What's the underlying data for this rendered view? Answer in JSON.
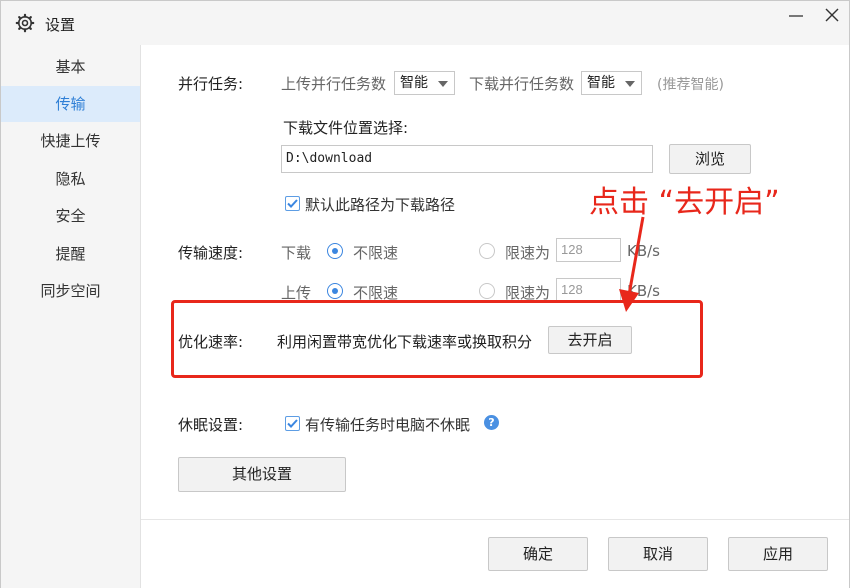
{
  "window": {
    "title": "设置",
    "icons": {
      "title": "gear-icon",
      "minimize": "minimize-icon",
      "close": "close-icon"
    }
  },
  "sidebar": {
    "items": [
      {
        "label": "基本",
        "active": false
      },
      {
        "label": "传输",
        "active": true
      },
      {
        "label": "快捷上传",
        "active": false
      },
      {
        "label": "隐私",
        "active": false
      },
      {
        "label": "安全",
        "active": false
      },
      {
        "label": "提醒",
        "active": false
      },
      {
        "label": "同步空间",
        "active": false
      }
    ]
  },
  "parallel": {
    "label": "并行任务:",
    "upload_label": "上传并行任务数",
    "upload_value": "智能",
    "download_label": "下载并行任务数",
    "download_value": "智能",
    "hint": "(推荐智能)"
  },
  "download_location": {
    "title": "下载文件位置选择:",
    "path": "D:\\download",
    "browse_label": "浏览",
    "default_checkbox_label": "默认此路径为下载路径",
    "default_checked": true
  },
  "speed": {
    "label": "传输速度:",
    "download": {
      "label": "下载",
      "unlimited_label": "不限速",
      "limited_label": "限速为",
      "limit_value": "128",
      "unit": "KB/s",
      "selected": "unlimited"
    },
    "upload": {
      "label": "上传",
      "unlimited_label": "不限速",
      "limited_label": "限速为",
      "limit_value": "128",
      "unit": "KB/s",
      "selected": "unlimited"
    }
  },
  "optimize": {
    "label": "优化速率:",
    "description": "利用闲置带宽优化下载速率或换取积分",
    "button_label": "去开启"
  },
  "sleep": {
    "label": "休眠设置:",
    "checkbox_label": "有传输任务时电脑不休眠",
    "checked": true,
    "help_icon": "?"
  },
  "other_settings_label": "其他设置",
  "footer": {
    "ok_label": "确定",
    "cancel_label": "取消",
    "apply_label": "应用"
  },
  "annotation": {
    "text": "点击 “去开启”",
    "color": "#e8271b"
  },
  "colors": {
    "accent": "#2f7fd6",
    "sidebar_active_bg": "#dcebfb",
    "annotation": "#e8271b"
  }
}
